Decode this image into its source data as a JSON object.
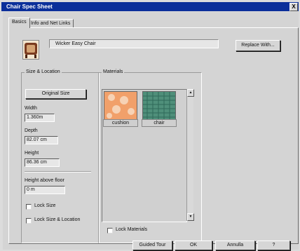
{
  "window": {
    "title": "Chair Spec Sheet",
    "close_glyph": "X"
  },
  "tabs": [
    {
      "label": "Basics"
    },
    {
      "label": "Info and Net Links"
    }
  ],
  "object": {
    "name": "Wicker Easy Chair",
    "thumbnail_icon": "chair-icon"
  },
  "buttons": {
    "replace_with": "Replace With...",
    "original_size": "Original Size",
    "guided_tour": "Guided Tour",
    "ok": "OK",
    "annuller": "Annulla",
    "help": "?"
  },
  "size_location": {
    "title": "Size & Location",
    "width_label": "Width",
    "width_value": "1.360m",
    "depth_label": "Depth",
    "depth_value": "82.07 cm",
    "height_label": "Height",
    "height_value": "86.36 cm",
    "height_above_floor_label": "Height above floor",
    "height_above_floor_value": "0 m",
    "lock_size_label": "Lock Size",
    "lock_size_location_label": "Lock Size & Location"
  },
  "materials": {
    "title": "Materials",
    "items": [
      {
        "label": "cushion",
        "color": "#f1a06a"
      },
      {
        "label": "chair",
        "color": "#4f8f7a"
      }
    ],
    "lock_materials_label": "Lock Materials"
  }
}
